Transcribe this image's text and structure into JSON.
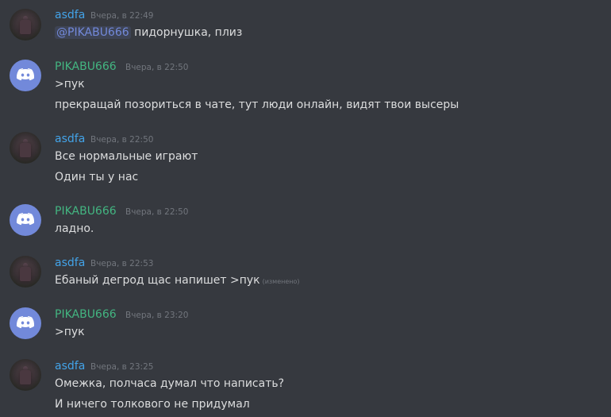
{
  "messages": [
    {
      "author": "asdfa",
      "time": "Вчера, в 22:49",
      "mention": "@PIKABU666",
      "lines": [
        "пидорнушка, плиз"
      ]
    },
    {
      "author": "PIKABU666",
      "time": "Вчера, в 22:50",
      "lines": [
        ">пук",
        "прекращай позориться в чате, тут люди онлайн, видят твои высеры"
      ]
    },
    {
      "author": "asdfa",
      "time": "Вчера, в 22:50",
      "lines": [
        "Все нормальные играют",
        "Один ты у нас"
      ]
    },
    {
      "author": "PIKABU666",
      "time": "Вчера, в 22:50",
      "lines": [
        "ладно."
      ]
    },
    {
      "author": "asdfa",
      "time": "Вчера, в 22:53",
      "lines": [
        "Ебаный дегрод щас напишет >пук"
      ],
      "edited": "(изменено)"
    },
    {
      "author": "PIKABU666",
      "time": "Вчера, в 23:20",
      "lines": [
        ">пук"
      ]
    },
    {
      "author": "asdfa",
      "time": "Вчера, в 23:25",
      "lines": [
        "Омежка, полчаса думал что написать?",
        "И ничего толкового не придумал"
      ]
    }
  ],
  "colors": {
    "background": "#36393f",
    "user_name": "#43a3e8",
    "bot_name": "#43b581",
    "text": "#dcddde",
    "timestamp": "#72767d",
    "mention": "#7289da"
  }
}
